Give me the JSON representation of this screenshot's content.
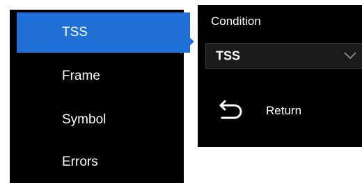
{
  "menu": {
    "items": [
      {
        "label": "TSS",
        "selected": true
      },
      {
        "label": "Frame",
        "selected": false
      },
      {
        "label": "Symbol",
        "selected": false
      },
      {
        "label": "Errors",
        "selected": false
      }
    ]
  },
  "panel": {
    "condition_label": "Condition",
    "condition_value": "TSS",
    "dropdown_icon": "chevron-down-icon",
    "return_label": "Return",
    "return_icon": "return-arrow-icon"
  },
  "colors": {
    "selected_bg": "#1f6fd6",
    "menu_bg": "#000000",
    "panel_bg": "#000000",
    "dropdown_bg": "#1b1b1b",
    "text": "#ffffff",
    "chevron": "#9a9a9a"
  }
}
